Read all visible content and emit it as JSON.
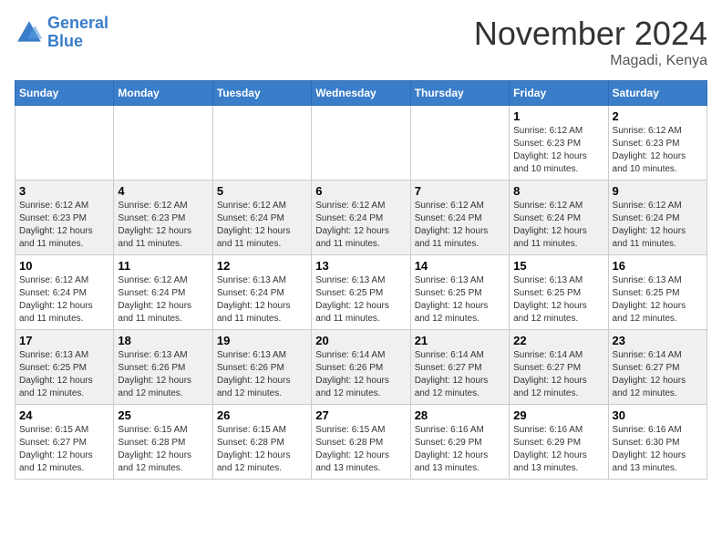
{
  "logo": {
    "text_general": "General",
    "text_blue": "Blue"
  },
  "title": "November 2024",
  "location": "Magadi, Kenya",
  "days_of_week": [
    "Sunday",
    "Monday",
    "Tuesday",
    "Wednesday",
    "Thursday",
    "Friday",
    "Saturday"
  ],
  "weeks": [
    [
      {
        "day": "",
        "info": ""
      },
      {
        "day": "",
        "info": ""
      },
      {
        "day": "",
        "info": ""
      },
      {
        "day": "",
        "info": ""
      },
      {
        "day": "",
        "info": ""
      },
      {
        "day": "1",
        "info": "Sunrise: 6:12 AM\nSunset: 6:23 PM\nDaylight: 12 hours\nand 10 minutes."
      },
      {
        "day": "2",
        "info": "Sunrise: 6:12 AM\nSunset: 6:23 PM\nDaylight: 12 hours\nand 10 minutes."
      }
    ],
    [
      {
        "day": "3",
        "info": "Sunrise: 6:12 AM\nSunset: 6:23 PM\nDaylight: 12 hours\nand 11 minutes."
      },
      {
        "day": "4",
        "info": "Sunrise: 6:12 AM\nSunset: 6:23 PM\nDaylight: 12 hours\nand 11 minutes."
      },
      {
        "day": "5",
        "info": "Sunrise: 6:12 AM\nSunset: 6:24 PM\nDaylight: 12 hours\nand 11 minutes."
      },
      {
        "day": "6",
        "info": "Sunrise: 6:12 AM\nSunset: 6:24 PM\nDaylight: 12 hours\nand 11 minutes."
      },
      {
        "day": "7",
        "info": "Sunrise: 6:12 AM\nSunset: 6:24 PM\nDaylight: 12 hours\nand 11 minutes."
      },
      {
        "day": "8",
        "info": "Sunrise: 6:12 AM\nSunset: 6:24 PM\nDaylight: 12 hours\nand 11 minutes."
      },
      {
        "day": "9",
        "info": "Sunrise: 6:12 AM\nSunset: 6:24 PM\nDaylight: 12 hours\nand 11 minutes."
      }
    ],
    [
      {
        "day": "10",
        "info": "Sunrise: 6:12 AM\nSunset: 6:24 PM\nDaylight: 12 hours\nand 11 minutes."
      },
      {
        "day": "11",
        "info": "Sunrise: 6:12 AM\nSunset: 6:24 PM\nDaylight: 12 hours\nand 11 minutes."
      },
      {
        "day": "12",
        "info": "Sunrise: 6:13 AM\nSunset: 6:24 PM\nDaylight: 12 hours\nand 11 minutes."
      },
      {
        "day": "13",
        "info": "Sunrise: 6:13 AM\nSunset: 6:25 PM\nDaylight: 12 hours\nand 11 minutes."
      },
      {
        "day": "14",
        "info": "Sunrise: 6:13 AM\nSunset: 6:25 PM\nDaylight: 12 hours\nand 12 minutes."
      },
      {
        "day": "15",
        "info": "Sunrise: 6:13 AM\nSunset: 6:25 PM\nDaylight: 12 hours\nand 12 minutes."
      },
      {
        "day": "16",
        "info": "Sunrise: 6:13 AM\nSunset: 6:25 PM\nDaylight: 12 hours\nand 12 minutes."
      }
    ],
    [
      {
        "day": "17",
        "info": "Sunrise: 6:13 AM\nSunset: 6:25 PM\nDaylight: 12 hours\nand 12 minutes."
      },
      {
        "day": "18",
        "info": "Sunrise: 6:13 AM\nSunset: 6:26 PM\nDaylight: 12 hours\nand 12 minutes."
      },
      {
        "day": "19",
        "info": "Sunrise: 6:13 AM\nSunset: 6:26 PM\nDaylight: 12 hours\nand 12 minutes."
      },
      {
        "day": "20",
        "info": "Sunrise: 6:14 AM\nSunset: 6:26 PM\nDaylight: 12 hours\nand 12 minutes."
      },
      {
        "day": "21",
        "info": "Sunrise: 6:14 AM\nSunset: 6:27 PM\nDaylight: 12 hours\nand 12 minutes."
      },
      {
        "day": "22",
        "info": "Sunrise: 6:14 AM\nSunset: 6:27 PM\nDaylight: 12 hours\nand 12 minutes."
      },
      {
        "day": "23",
        "info": "Sunrise: 6:14 AM\nSunset: 6:27 PM\nDaylight: 12 hours\nand 12 minutes."
      }
    ],
    [
      {
        "day": "24",
        "info": "Sunrise: 6:15 AM\nSunset: 6:27 PM\nDaylight: 12 hours\nand 12 minutes."
      },
      {
        "day": "25",
        "info": "Sunrise: 6:15 AM\nSunset: 6:28 PM\nDaylight: 12 hours\nand 12 minutes."
      },
      {
        "day": "26",
        "info": "Sunrise: 6:15 AM\nSunset: 6:28 PM\nDaylight: 12 hours\nand 12 minutes."
      },
      {
        "day": "27",
        "info": "Sunrise: 6:15 AM\nSunset: 6:28 PM\nDaylight: 12 hours\nand 13 minutes."
      },
      {
        "day": "28",
        "info": "Sunrise: 6:16 AM\nSunset: 6:29 PM\nDaylight: 12 hours\nand 13 minutes."
      },
      {
        "day": "29",
        "info": "Sunrise: 6:16 AM\nSunset: 6:29 PM\nDaylight: 12 hours\nand 13 minutes."
      },
      {
        "day": "30",
        "info": "Sunrise: 6:16 AM\nSunset: 6:30 PM\nDaylight: 12 hours\nand 13 minutes."
      }
    ]
  ]
}
